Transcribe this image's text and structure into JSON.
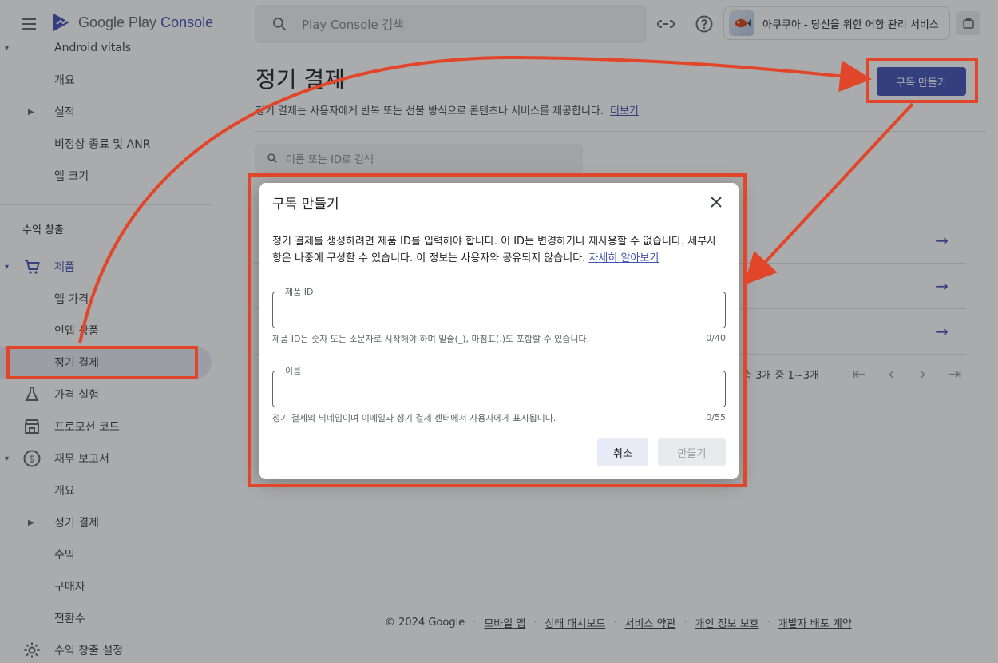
{
  "header": {
    "logo_text": "Google Play",
    "logo_console": "Console",
    "search_placeholder": "Play Console 검색",
    "app_name": "아쿠쿠아 - 당신을 위한 어항 관리 서비스"
  },
  "sidebar": {
    "cut_item": "Android vitals",
    "vitals_items": [
      "개요",
      "실적",
      "비정상 종료 및 ANR",
      "앱 크기"
    ],
    "section_monetize": "수익 창출",
    "products": "제품",
    "product_items": [
      "앱 가격",
      "인앱 상품",
      "정기 결제"
    ],
    "price_experiments": "가격 실험",
    "promo_codes": "프로모션 코드",
    "financial_reports": "재무 보고서",
    "finance_items": [
      "개요",
      "정기 결제",
      "수익",
      "구매자",
      "전환수"
    ],
    "monetize_settings": "수익 창출 설정"
  },
  "main": {
    "title": "정기 결제",
    "description": "정기 결제는 사용자에게 반복 또는 선불 방식으로 콘텐츠나 서비스를 제공합니다.",
    "learn_more": "더보기",
    "create_button": "구독 만들기",
    "filter_placeholder": "이름 또는 ID로 검색",
    "pagination_text": "총 3개 중 1~3개"
  },
  "dialog": {
    "title": "구독 만들기",
    "body": "정기 결제를 생성하려면 제품 ID를 입력해야 합니다. 이 ID는 변경하거나 재사용할 수 없습니다. 세부사항은 나중에 구성할 수 있습니다. 이 정보는 사용자와 공유되지 않습니다.",
    "learn_more": "자세히 알아보기",
    "product_id_label": "제품 ID",
    "product_id_value": "",
    "product_id_hint": "제품 ID는 숫자 또는 소문자로 시작해야 하며 밑줄(_), 마침표(.)도 포함할 수 있습니다.",
    "product_id_count": "0/40",
    "name_label": "이름",
    "name_value": "",
    "name_hint": "정기 결제의 닉네임이며 이메일과 정기 결제 센터에서 사용자에게 표시됩니다.",
    "name_count": "0/55",
    "cancel": "취소",
    "create": "만들기"
  },
  "footer": {
    "copyright": "© 2024 Google",
    "links": [
      "모바일 앱",
      "상태 대시보드",
      "서비스 약관",
      "개인 정보 보호",
      "개발자 배포 계약"
    ]
  },
  "colors": {
    "accent": "#3f51b5",
    "highlight": "#e2462a",
    "scrim": "rgba(32,33,36,0.38)"
  }
}
